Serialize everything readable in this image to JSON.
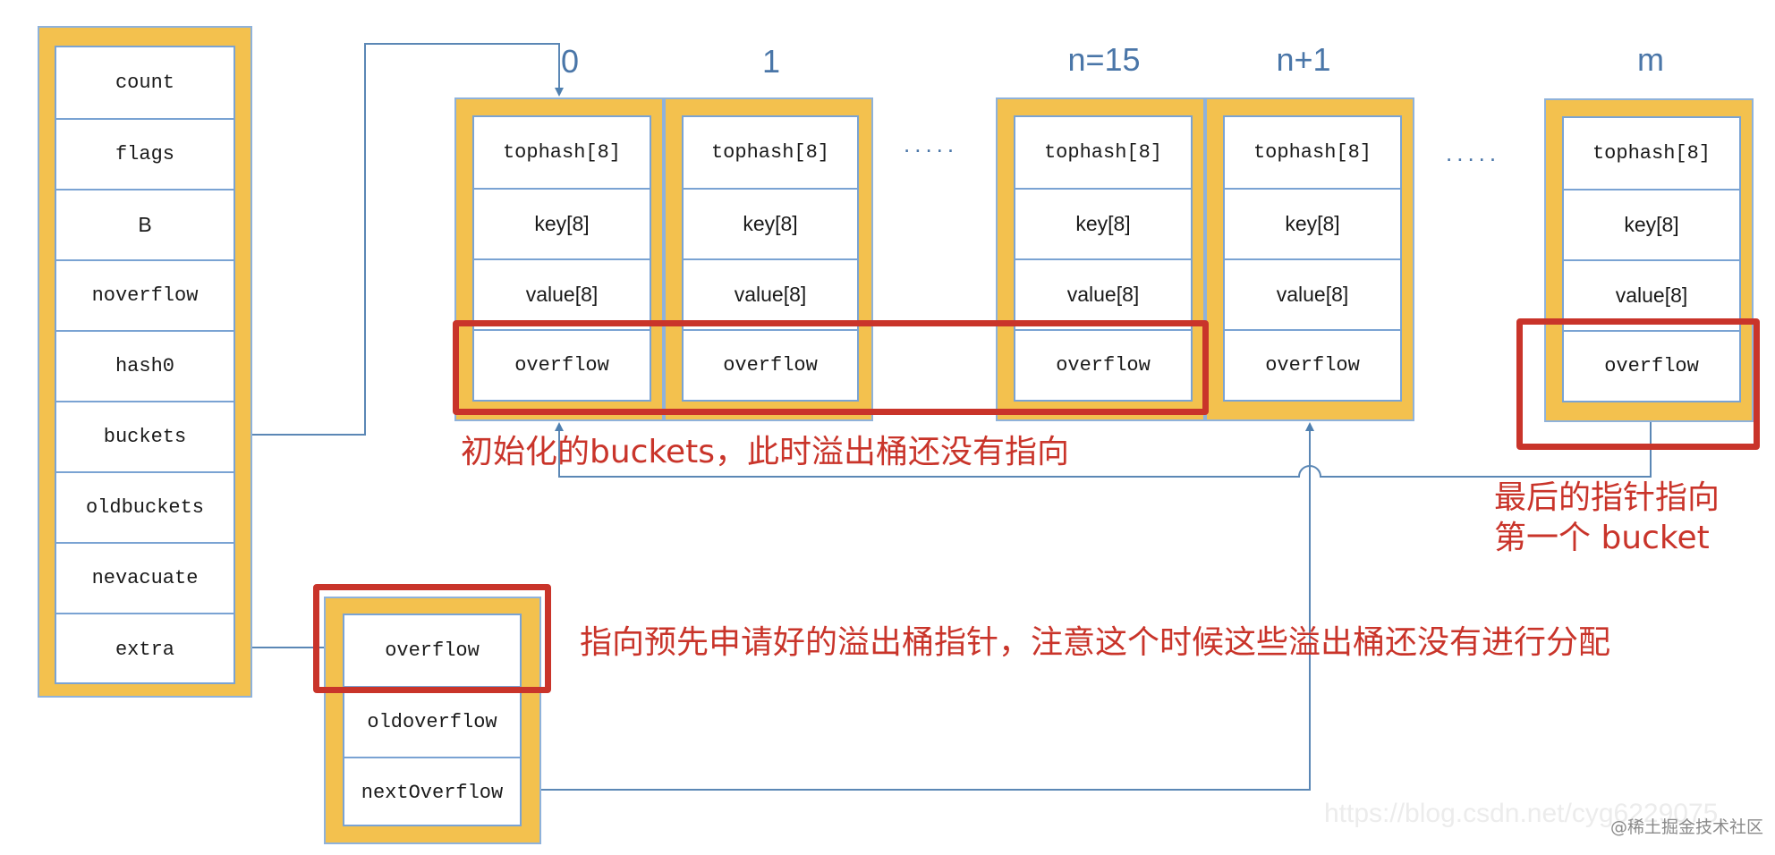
{
  "hmap": {
    "fields": [
      "count",
      "flags",
      "B",
      "noverflow",
      "hash0",
      "buckets",
      "oldbuckets",
      "nevacuate",
      "extra"
    ]
  },
  "buckets": [
    {
      "index_label": "0",
      "fields": [
        "tophash[8]",
        "key[8]",
        "value[8]",
        "overflow"
      ]
    },
    {
      "index_label": "1",
      "fields": [
        "tophash[8]",
        "key[8]",
        "value[8]",
        "overflow"
      ]
    },
    {
      "index_label": "n=15",
      "fields": [
        "tophash[8]",
        "key[8]",
        "value[8]",
        "overflow"
      ]
    },
    {
      "index_label": "n+1",
      "fields": [
        "tophash[8]",
        "key[8]",
        "value[8]",
        "overflow"
      ]
    },
    {
      "index_label": "m",
      "fields": [
        "tophash[8]",
        "key[8]",
        "value[8]",
        "overflow"
      ]
    }
  ],
  "ellipsis": ".....",
  "mapextra": {
    "fields": [
      "overflow",
      "oldoverflow",
      "nextOverflow"
    ]
  },
  "annotations": {
    "initial_buckets": "初始化的buckets，此时溢出桶还没有指向",
    "last_pointer_line1": "最后的指针指向",
    "last_pointer_line2": "第一个 bucket",
    "extra_note": "指向预先申请好的溢出桶指针，注意这个时候这些溢出桶还没有进行分配"
  },
  "watermark": {
    "url": "https://blog.csdn.net/cyg6229075",
    "site": "@稀土掘金技术社区"
  },
  "colors": {
    "box_fill": "#F3C14E",
    "border": "#7AA3D3",
    "highlight": "#C9342A",
    "label": "#4A76A8"
  }
}
